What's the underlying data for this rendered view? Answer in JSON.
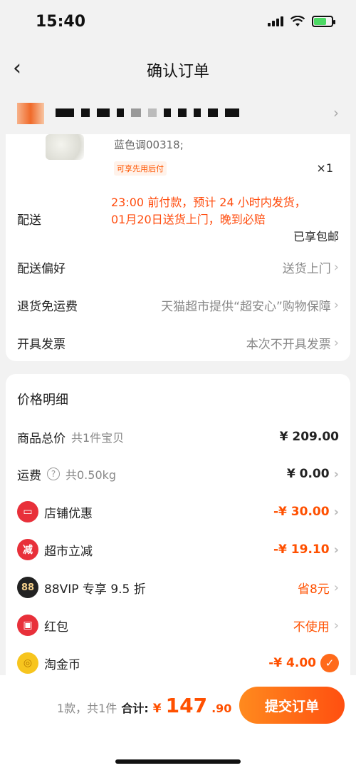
{
  "status_bar": {
    "time": "15:40"
  },
  "nav": {
    "back_icon": "‹",
    "title": "确认订单"
  },
  "address": {
    "chevron": "›"
  },
  "product": {
    "spec": "蓝色调00318;",
    "tag": "可享先用后付",
    "quantity": "×1"
  },
  "delivery": {
    "label": "配送",
    "notice_line1": "23:00 前付款，预计 24 小时内发货，",
    "notice_line2": "01月20日送货上门，晚到必赔",
    "free_shipping": "已享包邮"
  },
  "options": [
    {
      "label": "配送偏好",
      "value": "送货上门"
    },
    {
      "label": "退货免运费",
      "value": "天猫超市提供“超安心”购物保障"
    },
    {
      "label": "开具发票",
      "value": "本次不开具发票"
    }
  ],
  "price": {
    "title": "价格明细",
    "goods_label": "商品总价",
    "goods_sub": "共1件宝贝",
    "goods_value": "¥ 209.00",
    "freight_label": "运费",
    "freight_sub": "共0.50kg",
    "freight_value": "¥ 0.00",
    "shop_discount_label": "店铺优惠",
    "shop_discount_value": "-¥ 30.00",
    "market_discount_label": "超市立减",
    "market_discount_value": "-¥ 19.10",
    "vip_label": "88VIP 专享 9.5 折",
    "vip_value": "省8元",
    "redpacket_label": "红包",
    "redpacket_value": "不使用",
    "coin_label": "淘金币",
    "coin_value": "-¥ 4.00"
  },
  "bottom": {
    "count": "1款，共1件",
    "total_label": "合计:",
    "yen": "¥",
    "total_int": "147",
    "total_dec": ".90",
    "submit": "提交订单"
  },
  "colors": {
    "accent": "#ff5000",
    "notice": "#ff4d0f"
  }
}
